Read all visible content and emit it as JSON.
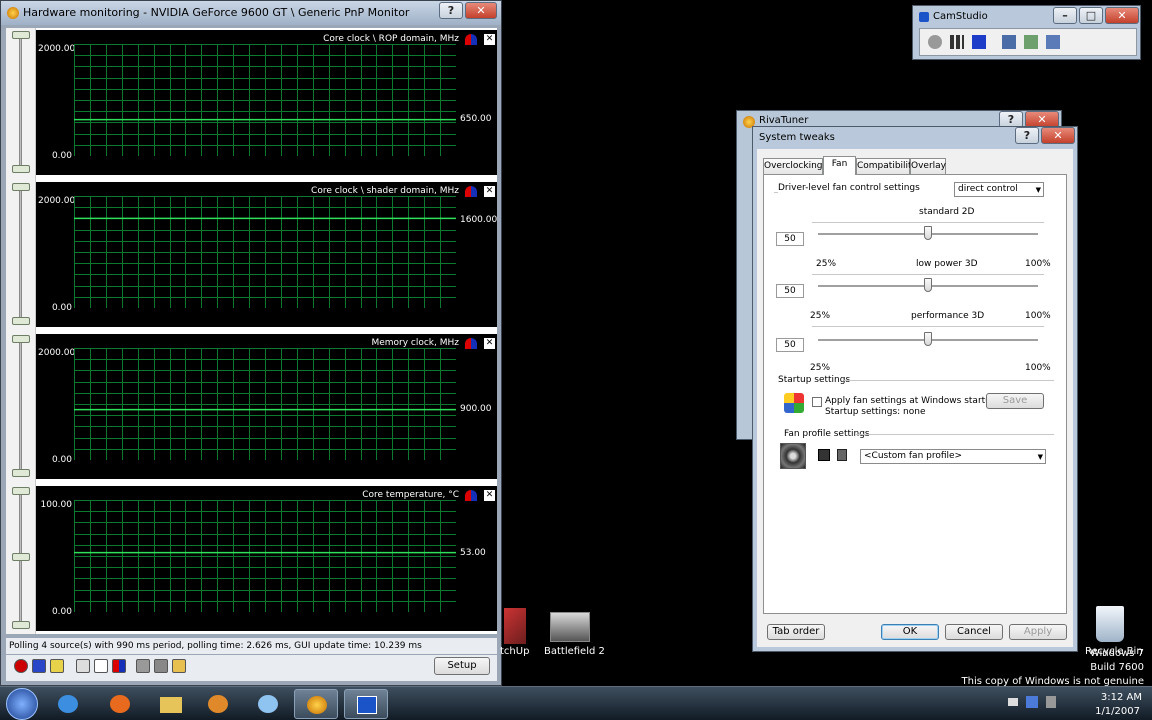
{
  "hw_window": {
    "title": "Hardware monitoring - NVIDIA GeForce 9600 GT \\ Generic PnP Monitor",
    "graphs": [
      {
        "title": "Core clock \\ ROP domain, MHz",
        "ymax": "2000.00",
        "ymin": "0.00",
        "current": "650.00",
        "value": 650,
        "max": 2000
      },
      {
        "title": "Core clock \\ shader domain, MHz",
        "ymax": "2000.00",
        "ymin": "0.00",
        "current": "1600.00",
        "value": 1600,
        "max": 2000
      },
      {
        "title": "Memory clock, MHz",
        "ymax": "2000.00",
        "ymin": "0.00",
        "current": "900.00",
        "value": 900,
        "max": 2000
      },
      {
        "title": "Core temperature, °C",
        "ymax": "100.00",
        "ymin": "0.00",
        "current": "53.00",
        "value": 53,
        "max": 100
      }
    ],
    "status": "Polling 4 source(s) with 990 ms period, polling time: 2.626 ms, GUI update time: 10.239 ms",
    "setup_label": "Setup"
  },
  "camstudio": {
    "title": "CamStudio"
  },
  "riva_window": {
    "title": "RivaTuner"
  },
  "system_tweaks": {
    "title": "System tweaks",
    "tabs": [
      "Overclocking",
      "Fan",
      "Compatibility",
      "Overlay"
    ],
    "active_tab": "Fan",
    "driver_fan_label": "Driver-level fan control settings",
    "control_mode": "direct control",
    "sliders": [
      {
        "label": "standard 2D",
        "value": "50",
        "min_label": "25%",
        "max_label": "100%",
        "pct": 50
      },
      {
        "label": "low power 3D",
        "value": "50",
        "min_label": "25%",
        "max_label": "100%",
        "pct": 50
      },
      {
        "label": "performance 3D",
        "value": "50",
        "min_label": "25%",
        "max_label": "100%",
        "pct": 50
      }
    ],
    "startup_settings_label": "Startup settings",
    "apply_checkbox_label": "Apply fan settings at Windows startup",
    "startup_settings_value": "Startup settings:  none",
    "save_label": "Save",
    "fan_profile_label": "Fan profile settings",
    "profile_value": "<Custom fan profile>",
    "tab_order_label": "Tab order",
    "ok_label": "OK",
    "cancel_label": "Cancel",
    "apply_label": "Apply"
  },
  "desktop": {
    "icons": [
      {
        "label": "tchUp"
      },
      {
        "label": "Battlefield 2"
      },
      {
        "label": "Recycle Bin"
      }
    ],
    "watermark": [
      "Windows 7",
      "Build 7600",
      "This copy of Windows is not genuine"
    ]
  },
  "taskbar": {
    "time": "3:12 AM",
    "date": "1/1/2007"
  }
}
